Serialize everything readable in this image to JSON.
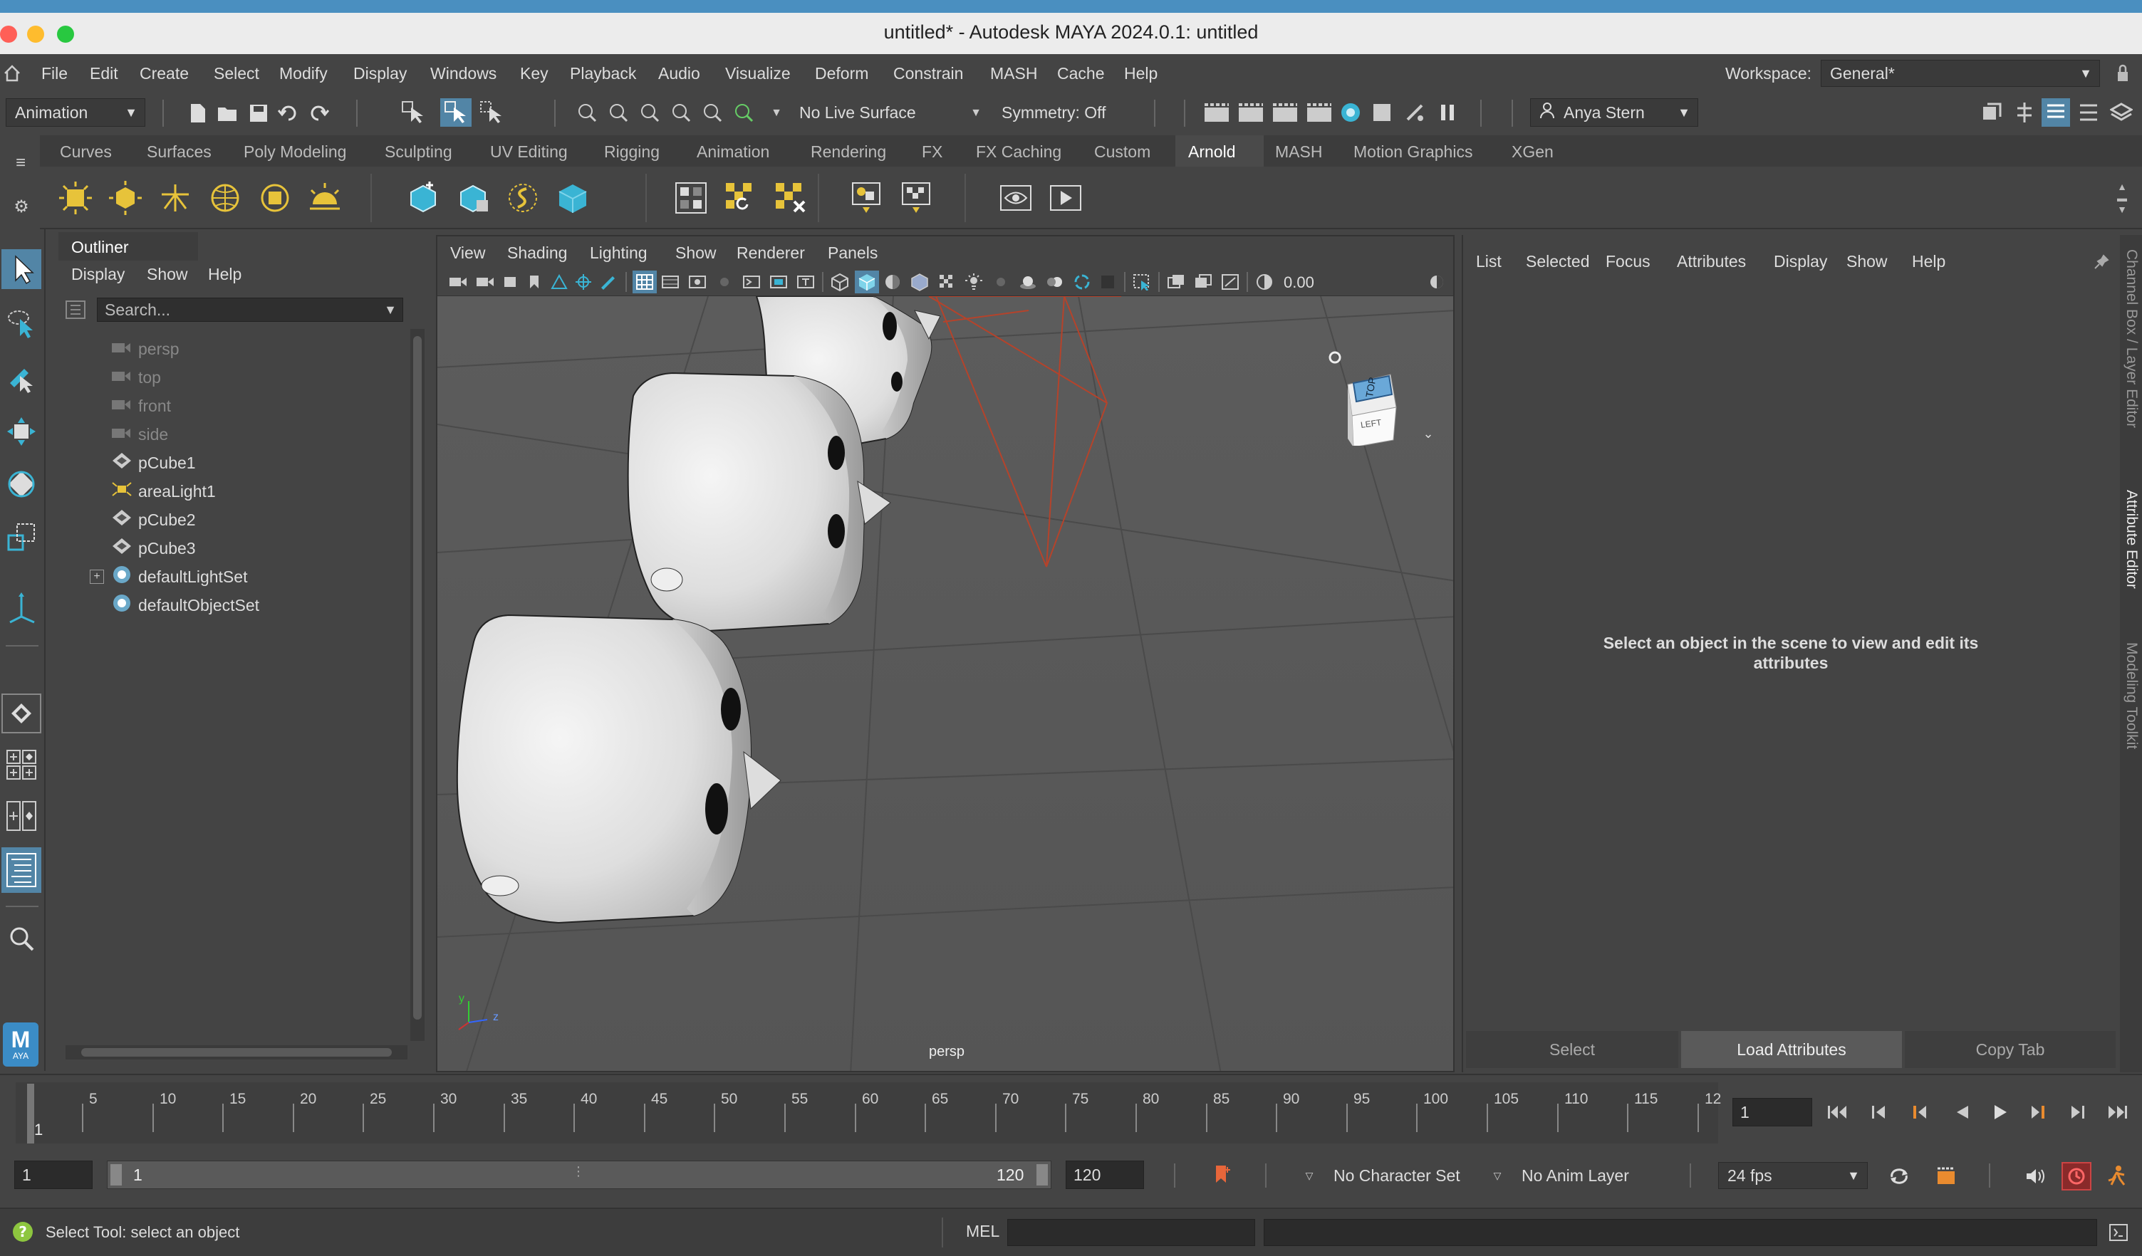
{
  "window": {
    "title": "untitled* - Autodesk MAYA 2024.0.1: untitled"
  },
  "menu": [
    "File",
    "Edit",
    "Create",
    "Select",
    "Modify",
    "Display",
    "Windows",
    "Key",
    "Playback",
    "Audio",
    "Visualize",
    "Deform",
    "Constrain",
    "MASH",
    "Cache",
    "Help"
  ],
  "workspace": {
    "label": "Workspace:",
    "value": "General*"
  },
  "toolbar": {
    "mode": "Animation",
    "live_surface": "No Live Surface",
    "symmetry": "Symmetry: Off",
    "user": "Anya Stern"
  },
  "shelf_tabs": [
    "Curves",
    "Surfaces",
    "Poly Modeling",
    "Sculpting",
    "UV Editing",
    "Rigging",
    "Animation",
    "Rendering",
    "FX",
    "FX Caching",
    "Custom",
    "Arnold",
    "MASH",
    "Motion Graphics",
    "XGen"
  ],
  "shelf_active": "Arnold",
  "outliner": {
    "title": "Outliner",
    "menu": [
      "Display",
      "Show",
      "Help"
    ],
    "search_placeholder": "Search...",
    "items": [
      {
        "label": "persp",
        "icon": "camera-icon"
      },
      {
        "label": "top",
        "icon": "camera-icon"
      },
      {
        "label": "front",
        "icon": "camera-icon"
      },
      {
        "label": "side",
        "icon": "camera-icon"
      },
      {
        "label": "pCube1",
        "icon": "mesh-icon"
      },
      {
        "label": "areaLight1",
        "icon": "area-light-icon"
      },
      {
        "label": "pCube2",
        "icon": "mesh-icon"
      },
      {
        "label": "pCube3",
        "icon": "mesh-icon"
      },
      {
        "label": "defaultLightSet",
        "icon": "set-icon"
      },
      {
        "label": "defaultObjectSet",
        "icon": "set-icon"
      }
    ]
  },
  "viewport": {
    "menu": [
      "View",
      "Shading",
      "Lighting",
      "Show",
      "Renderer",
      "Panels"
    ],
    "exposure": "0.00",
    "camera_label": "persp",
    "cube_top": "TOP",
    "cube_left": "LEFT",
    "axis_y": "y",
    "axis_z": "z"
  },
  "attribute_editor": {
    "menu": [
      "List",
      "Selected",
      "Focus",
      "Attributes",
      "Display",
      "Show",
      "Help"
    ],
    "message_line1": "Select an object in the scene to view and edit its",
    "message_line2": "attributes",
    "buttons": [
      "Select",
      "Load Attributes",
      "Copy Tab"
    ]
  },
  "right_tabs": [
    "Channel Box / Layer Editor",
    "Attribute Editor",
    "Modeling Toolkit"
  ],
  "timeline": {
    "ticks": [
      "5",
      "10",
      "15",
      "20",
      "25",
      "30",
      "35",
      "40",
      "45",
      "50",
      "55",
      "60",
      "65",
      "70",
      "75",
      "80",
      "85",
      "90",
      "95",
      "100",
      "105",
      "110",
      "115",
      "12"
    ],
    "current_frame": "1",
    "current_field": "1"
  },
  "range": {
    "start": "1",
    "range_start": "1",
    "range_end": "120",
    "end": "120",
    "character_set": "No Character Set",
    "anim_layer": "No Anim Layer",
    "fps": "24 fps"
  },
  "status": {
    "help_text": "Select Tool: select an object",
    "mel_label": "MEL"
  },
  "logo": {
    "letter": "M",
    "sub": "AYA"
  }
}
